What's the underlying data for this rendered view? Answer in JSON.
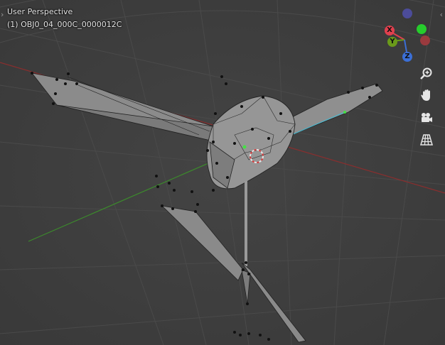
{
  "viewport": {
    "title": "User Perspective",
    "object_name": "(1) OBJ0_04_000C_0000012C"
  },
  "gizmo": {
    "axis_x_label": "X",
    "axis_y_label": "Y",
    "axis_z_label": "Z",
    "colors": {
      "x": "#e0404e",
      "y": "#6a9a1a",
      "z": "#3b6fd6",
      "neg_x": "#9a3a3e",
      "neg_y": "#26cc2c",
      "neg_z": "#4c4c9a"
    }
  },
  "nav_tools": [
    "zoom-icon",
    "hand-pan-icon",
    "camera-icon",
    "grid-perspective-icon"
  ],
  "arrows": {
    "left": "›",
    "right": "‹"
  }
}
